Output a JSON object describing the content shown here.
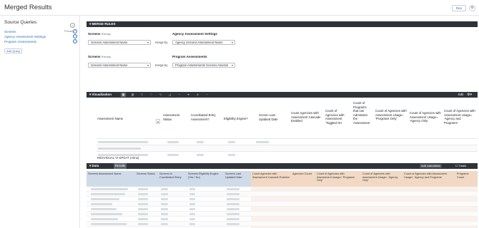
{
  "header": {
    "title": "Merged Results",
    "run_label": "Run",
    "settings_icon": "gear-icon"
  },
  "sidebar": {
    "title": "Source Queries",
    "items": [
      {
        "label": "Screens",
        "badge": "Primary"
      },
      {
        "label": "Agency Assessment Settings",
        "badge": ""
      },
      {
        "label": "Program Assessments",
        "badge": ""
      }
    ],
    "add_query_label": "Add Query"
  },
  "merge_rules": {
    "header": "MERGE RULES",
    "rows": [
      {
        "left_label": "Screens",
        "left_badge": "Primary",
        "left_field": "Screens Assessment Name",
        "merge_by": "merge by",
        "right_label": "Agency Assessment Settings",
        "right_field": "Agency Screens Assessment Name"
      },
      {
        "left_label": "Screens",
        "left_badge": "Primary",
        "left_field": "Screens Assessment Name",
        "merge_by": "merge by",
        "right_label": "Program Assessments",
        "right_field": "Program Assessments Screens Assessr"
      }
    ]
  },
  "visualization": {
    "header": "Visualization",
    "edit_label": "Edit",
    "columns": [
      "Assessment Name",
      "Assessment Status",
      "Coordinated Entry Assessment?",
      "Eligibility Engine?",
      "Screen Last Updated Date",
      "Count Agencies with Assessment Cascade Enabled",
      "Count of Agencies with Assessment 'Toggled On'",
      "Count of Programs that can Administer the Assessment",
      "Count of Agencies with Assessment Usage= 'Programs Only'",
      "Count of Agencies with Assessment Usage= 'Agency Only'",
      "Count of Agencies with Assessment Usage= 'Agency and Programs'"
    ],
    "visible_row_label": "INDIVIDUAL VI-SPDAT (Alma)"
  },
  "data": {
    "tab_data": "Data",
    "tab_results": "Results",
    "add_calculation_label": "Add calculation",
    "totals_label": "Totals",
    "columns": [
      {
        "label": "Screens Assessment Name",
        "group": "blue"
      },
      {
        "label": "Screens Status",
        "group": "blue"
      },
      {
        "label": "Screens Is Coordinated Entry",
        "group": "blue"
      },
      {
        "label": "Screens Eligibility Engine (Yes / No)",
        "group": "blue"
      },
      {
        "label": "Screens Last Updated Date",
        "group": "blue"
      },
      {
        "label": "Count Agencies with Assessment Cascade Enabled",
        "group": "orange"
      },
      {
        "label": "Agencies Count",
        "group": "orange"
      },
      {
        "label": "Count of Agencies with Assessment Usage= 'Programs Only'",
        "group": "orange"
      },
      {
        "label": "Count of Agencies with Assessment Usage= 'Agency Only'",
        "group": "orange"
      },
      {
        "label": "Count of Agencies with Assessment Usage= 'Agency and Programs'",
        "group": "orange"
      },
      {
        "label": "Programs Count",
        "group": "orange"
      }
    ]
  },
  "colors": {
    "dark_bar": "#2e3338",
    "link": "#2b6fb5",
    "dim_header": "#cfdbe9",
    "measure_header": "#f2d9c5"
  }
}
